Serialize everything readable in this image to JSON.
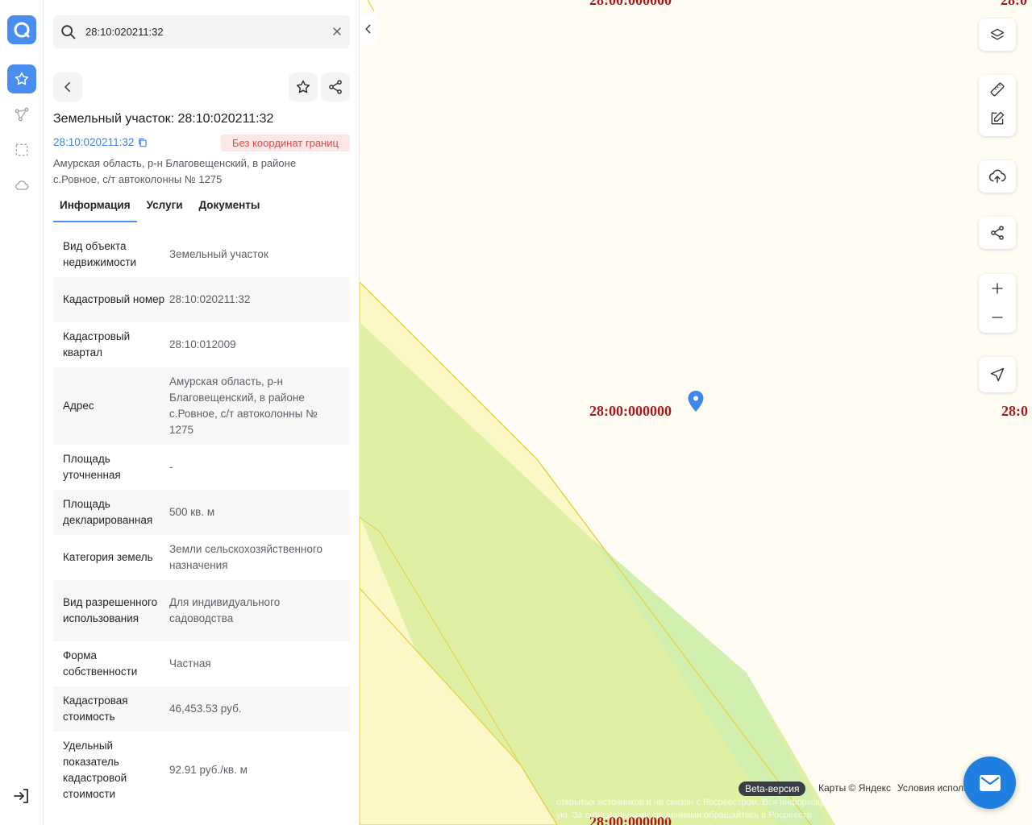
{
  "search": {
    "value": "28:10:020211:32"
  },
  "object": {
    "title": "Земельный участок: 28:10:020211:32",
    "cadastral_number": "28:10:020211:32",
    "badge": "Без координат границ",
    "address": "Амурская область, р-н Благовещенский, в районе с.Ровное, с/т автоколонны № 1275"
  },
  "tabs": [
    {
      "label": "Информация",
      "active": true
    },
    {
      "label": "Услуги",
      "active": false
    },
    {
      "label": "Документы",
      "active": false
    }
  ],
  "info_rows": [
    {
      "key": "Вид объекта недвижимости",
      "value": "Земельный участок"
    },
    {
      "key": "Кадастровый номер",
      "value": "28:10:020211:32"
    },
    {
      "key": "Кадастровый квартал",
      "value": "28:10:012009"
    },
    {
      "key": "Адрес",
      "value": "Амурская область, р-н Благовещенский, в районе с.Ровное, с/т автоколонны № 1275"
    },
    {
      "key": "Площадь уточненная",
      "value": "-"
    },
    {
      "key": "Площадь декларированная",
      "value": "500 кв. м"
    },
    {
      "key": "Категория земель",
      "value": "Земли сельскохозяйственного назначения"
    },
    {
      "key": "Вид разрешенного использования",
      "value": "Для индивидуального садоводства"
    },
    {
      "key": "Форма собственности",
      "value": "Частная"
    },
    {
      "key": "Кадастровая стоимость",
      "value": "46,453.53 руб."
    },
    {
      "key": "Удельный показатель кадастровой стоимости",
      "value": "92.91 руб./кв. м"
    }
  ],
  "map": {
    "quarter_label": "28:00:000000",
    "quarter_label_partial_top": "28:0",
    "quarter_label_partial_mid": "28:0",
    "beta": "Beta-версия",
    "attribution": "Карты © Яндекс",
    "terms": "Условия использования",
    "disclaimer_1": "открытых источников и не связан с Росреестром. Вся информация",
    "disclaimer_2": "ую. За официальными сведениями обращайтесь в Росреестр"
  },
  "colors": {
    "accent": "#4a8df0",
    "badge_bg": "#fde6e6",
    "badge_text": "#e04a4a",
    "quarter_label": "#a11d1d",
    "map_bg": "#fffdf3"
  }
}
